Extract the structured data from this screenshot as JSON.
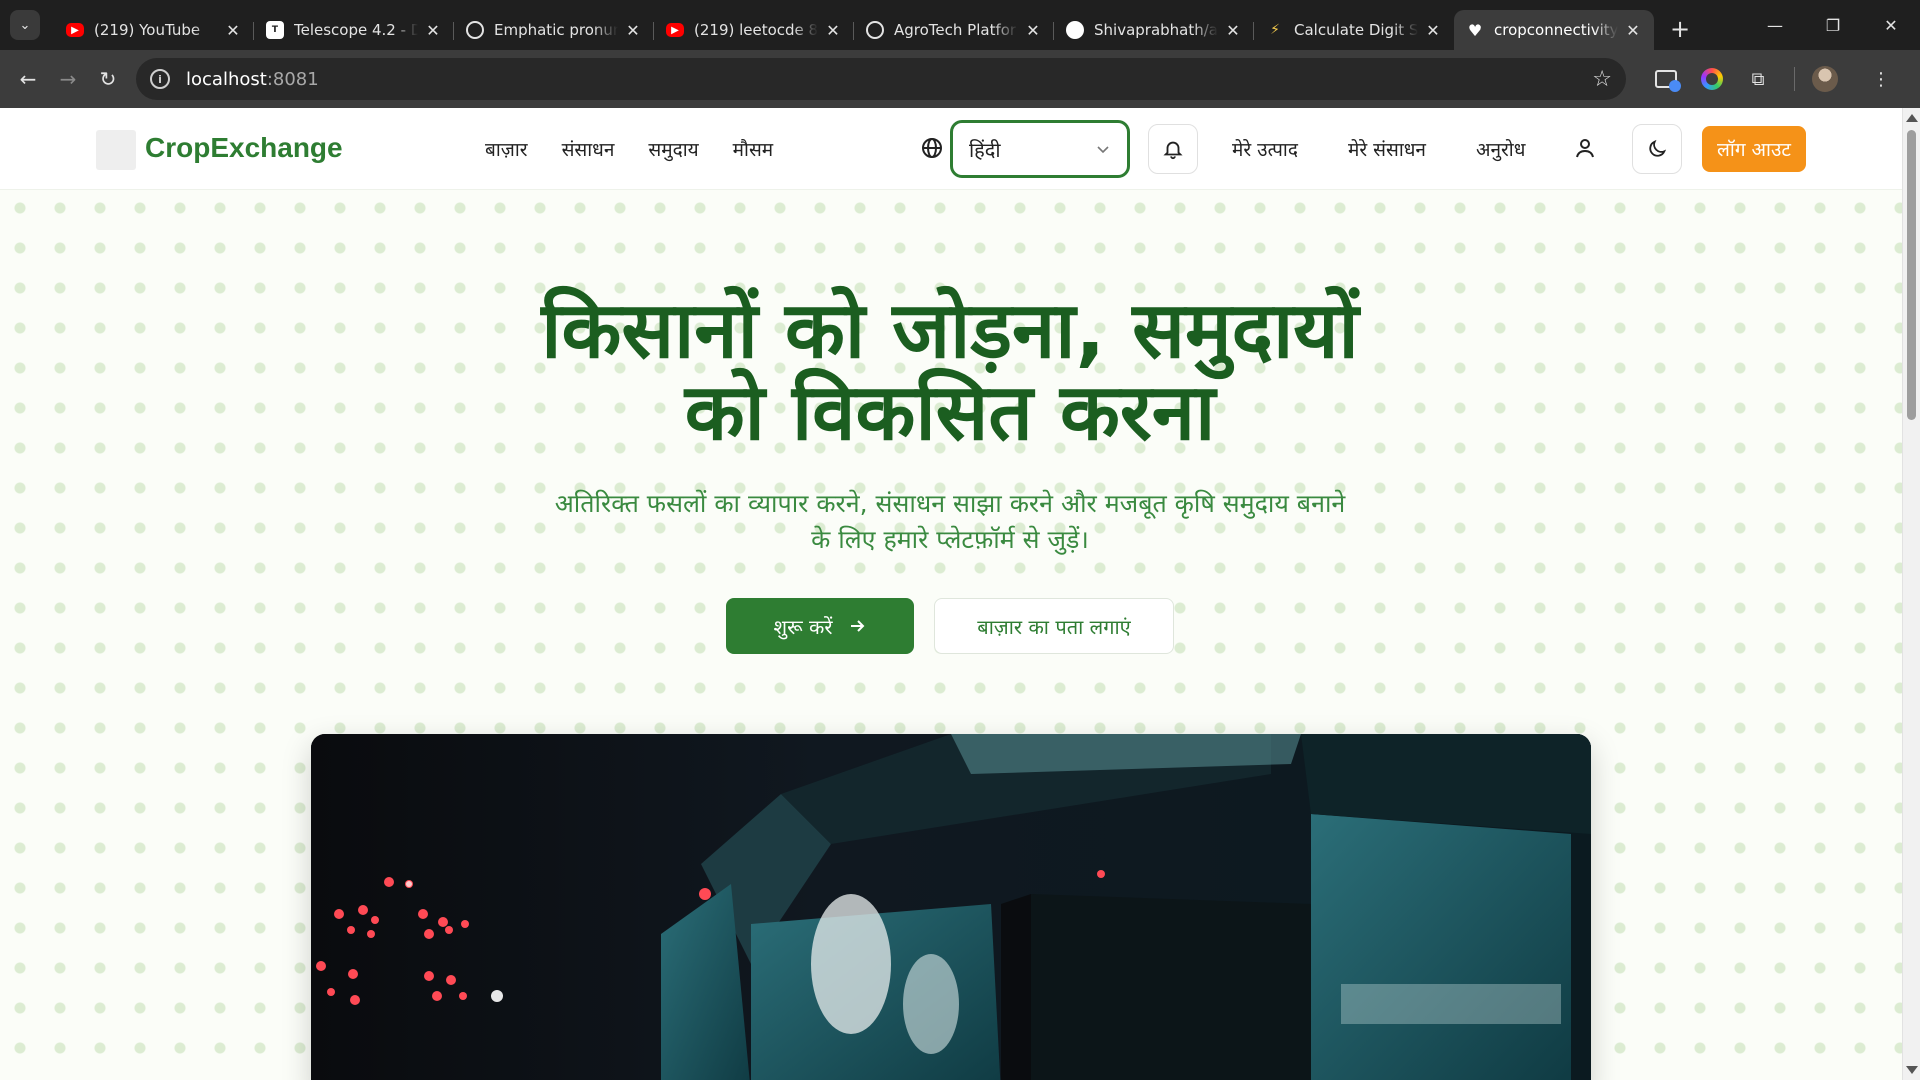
{
  "browser": {
    "tabs": [
      {
        "title": "(219) YouTube",
        "favicon": "youtube-icon",
        "active": false
      },
      {
        "title": "Telescope 4.2 - D",
        "favicon": "telescope-icon",
        "active": false
      },
      {
        "title": "Emphatic pronun",
        "favicon": "chatgpt-icon",
        "active": false
      },
      {
        "title": "(219) leetocde 80",
        "favicon": "youtube-icon",
        "active": false
      },
      {
        "title": "AgroTech Platfor",
        "favicon": "chatgpt-icon",
        "active": false
      },
      {
        "title": "Shivaprabhath/a",
        "favicon": "github-icon",
        "active": false
      },
      {
        "title": "Calculate Digit S",
        "favicon": "calculator-icon",
        "active": false
      },
      {
        "title": "cropconnectivity",
        "favicon": "heart-icon",
        "active": true
      }
    ],
    "url": {
      "host": "localhost",
      "port": ":8081"
    }
  },
  "site": {
    "brand": "CropExchange",
    "nav": [
      "बाज़ार",
      "संसाधन",
      "समुदाय",
      "मौसम"
    ],
    "language": {
      "selected": "हिंदी"
    },
    "right_nav": [
      "मेरे उत्पाद",
      "मेरे संसाधन",
      "अनुरोध"
    ],
    "logout": "लॉग आउट"
  },
  "hero": {
    "title_line1": "किसानों को जोड़ना, समुदायों",
    "title_line2": "को विकसित करना",
    "subtitle_line1": "अतिरिक्त फसलों का व्यापार करने, संसाधन साझा करने और मजबूत कृषि समुदाय बनाने",
    "subtitle_line2": "के लिए हमारे प्लेटफ़ॉर्म से जुड़ें।",
    "primary_cta": "शुरू करें",
    "secondary_cta": "बाज़ार का पता लगाएं"
  },
  "colors": {
    "brand_green": "#2e7d32",
    "title_green": "#1b5e20",
    "accent_orange": "#f59218"
  }
}
